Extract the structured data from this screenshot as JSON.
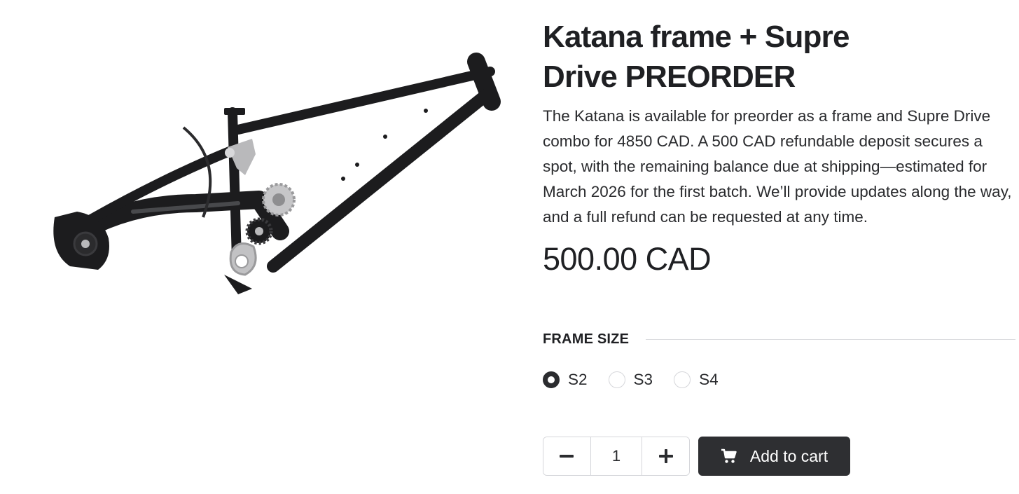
{
  "product": {
    "image_alt": "Katana frame with Supre Drive",
    "title": "Katana frame + Supre Drive PREORDER",
    "description": "The Katana is available for preorder as a frame and Supre Drive combo for 4850 CAD. A 500 CAD refundable deposit secures a spot, with the remaining balance due at shipping—estimated for March 2026 for the first batch. We’ll provide updates along the way, and a full refund can be requested at any time.",
    "price": "500.00 CAD"
  },
  "options": {
    "frame_size": {
      "label": "FRAME SIZE",
      "choices": [
        {
          "label": "S2",
          "selected": true
        },
        {
          "label": "S3",
          "selected": false
        },
        {
          "label": "S4",
          "selected": false
        }
      ]
    }
  },
  "purchase": {
    "quantity": "1",
    "decrease_icon": "minus-icon",
    "increase_icon": "plus-icon",
    "add_to_cart_label": "Add to cart",
    "cart_icon": "cart-icon"
  },
  "colors": {
    "text": "#222325",
    "button_bg": "#2e2f32",
    "border": "#d5d6da",
    "frame": "#1c1c1e",
    "alloy": "#b9b9bb"
  }
}
